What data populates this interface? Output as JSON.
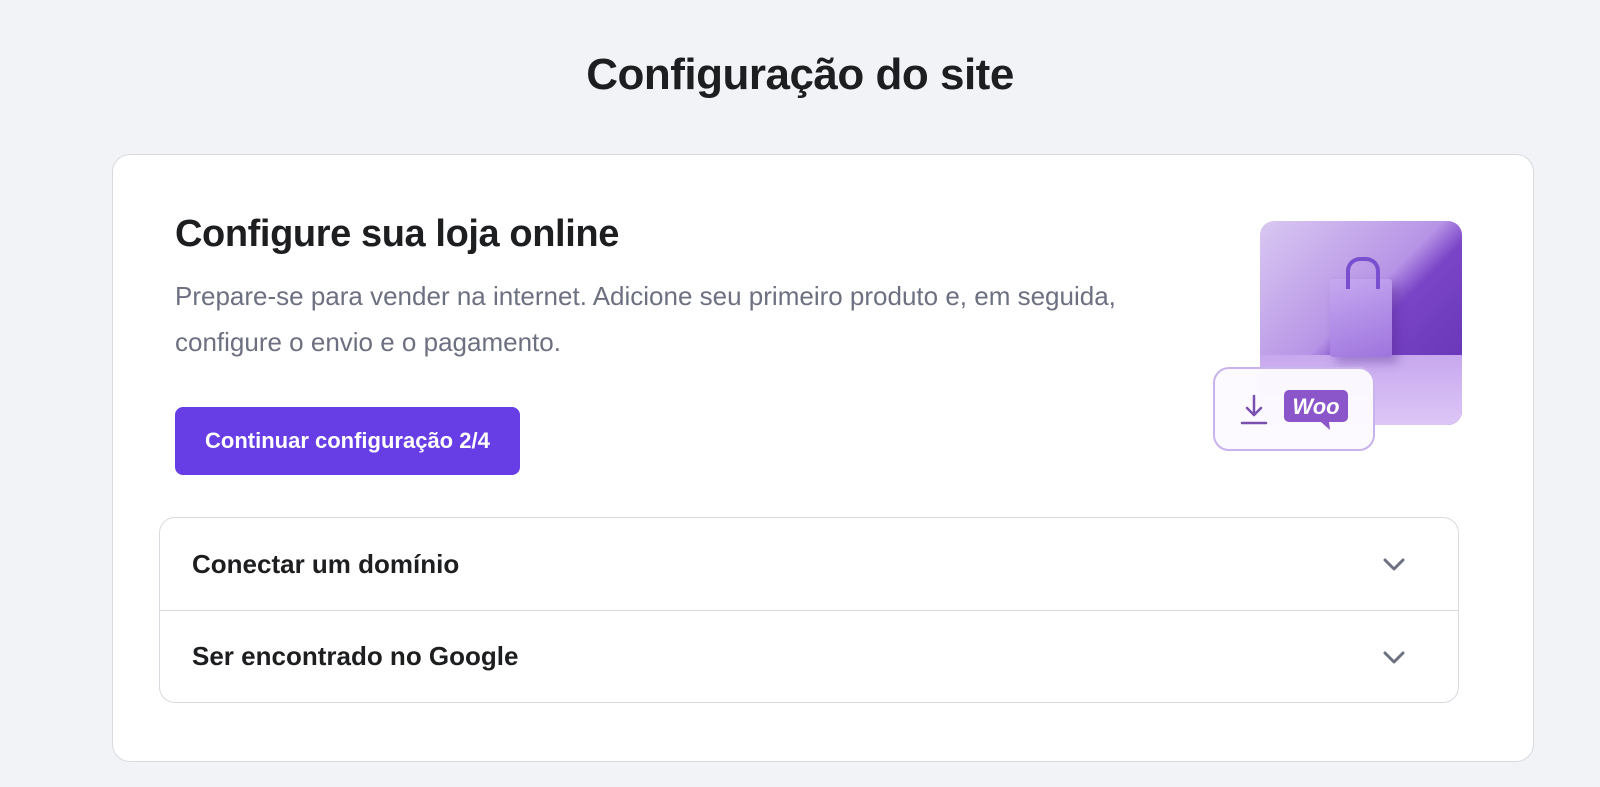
{
  "page": {
    "title": "Configuração do site"
  },
  "store_setup": {
    "title": "Configure sua loja online",
    "description": "Prepare-se para vender na internet. Adicione seu primeiro produto e, em seguida, configure o envio e o pagamento.",
    "button_label": "Continuar configuração 2/4",
    "logo_text": "Woo"
  },
  "accordion": {
    "items": [
      {
        "label": "Conectar um domínio",
        "icon": "chevron-down-icon"
      },
      {
        "label": "Ser encontrado no Google",
        "icon": "chevron-down-icon"
      }
    ]
  },
  "colors": {
    "accent": "#673de6",
    "background": "#f1f3f7",
    "card": "#ffffff",
    "muted_text": "#6d7081"
  }
}
